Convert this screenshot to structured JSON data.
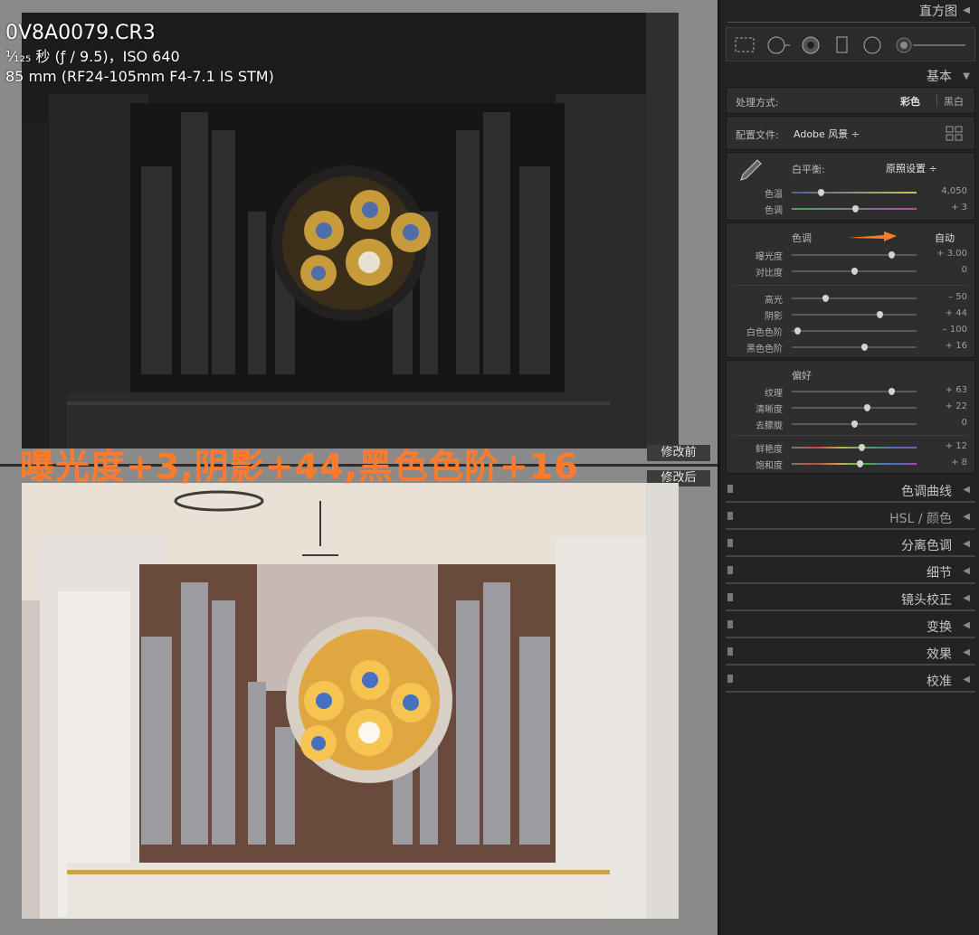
{
  "photo_info": {
    "filename": "0V8A0079.CR3",
    "shutter_aperture_iso": "¹⁄₁₂₅ 秒 (ƒ / 9.5)，ISO 640",
    "lens": "85 mm (RF24-105mm F4-7.1 IS STM)"
  },
  "labels": {
    "before": "修改前",
    "after": "修改后"
  },
  "annotation": "曝光度+3,阴影+44,黑色色阶+16",
  "panel": {
    "histogram_title": "直方图",
    "basic_title": "基本",
    "treatment_label": "处理方式:",
    "treatment_color": "彩色",
    "treatment_bw": "黑白",
    "profile_label": "配置文件:",
    "profile_value": "Adobe 风景 ÷",
    "wb_label": "白平衡:",
    "wb_value": "原照设置 ÷",
    "tone_label": "色调",
    "auto_button": "自动",
    "presence_label": "偏好",
    "sliders": {
      "temp": {
        "label": "色温",
        "value": "4,050",
        "pos": 0.23
      },
      "tint": {
        "label": "色调",
        "value": "+ 3",
        "pos": 0.51
      },
      "exposure": {
        "label": "曝光度",
        "value": "+ 3.00",
        "pos": 0.8
      },
      "contrast": {
        "label": "对比度",
        "value": "0",
        "pos": 0.5
      },
      "highlights": {
        "label": "高光",
        "value": "– 50",
        "pos": 0.27
      },
      "shadows": {
        "label": "阴影",
        "value": "+ 44",
        "pos": 0.7
      },
      "whites": {
        "label": "白色色阶",
        "value": "– 100",
        "pos": 0.04
      },
      "blacks": {
        "label": "黑色色阶",
        "value": "+ 16",
        "pos": 0.58
      },
      "texture": {
        "label": "纹理",
        "value": "+ 63",
        "pos": 0.8
      },
      "clarity": {
        "label": "清晰度",
        "value": "+ 22",
        "pos": 0.6
      },
      "dehaze": {
        "label": "去朦胧",
        "value": "0",
        "pos": 0.5
      },
      "vibrance": {
        "label": "鲜艳度",
        "value": "+ 12",
        "pos": 0.56
      },
      "saturation": {
        "label": "饱和度",
        "value": "+ 8",
        "pos": 0.54
      }
    },
    "collapsed_sections": [
      "色调曲线",
      "HSL / 颜色",
      "分离色调",
      "细节",
      "镜头校正",
      "变换",
      "效果",
      "校准"
    ]
  },
  "colors": {
    "annotation": "#ff7a2a",
    "arrow": "#ff7a2a",
    "panel_bg": "#232323"
  }
}
